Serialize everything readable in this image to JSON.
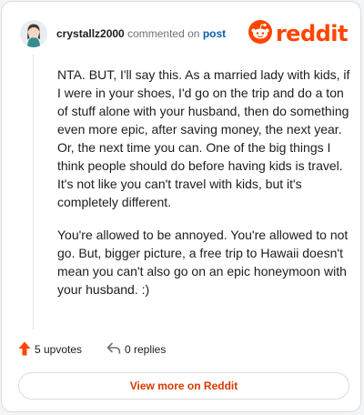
{
  "header": {
    "username": "crystallz2000",
    "action_text": "commented on",
    "post_link": "post",
    "logo_text": "reddit"
  },
  "comment": {
    "paragraphs": [
      "NTA. BUT, I'll say this. As a married lady with kids, if I were in your shoes, I'd go on the trip and do a ton of stuff alone with your husband, then do something even more epic, after saving money, the next year. Or, the next time you can. One of the big things I think people should do before having kids is travel. It's not like you can't travel with kids, but it's completely different.",
      "You're allowed to be annoyed. You're allowed to not go. But, bigger picture, a free trip to Hawaii doesn't mean you can't also go on an epic honeymoon with your husband. :)"
    ]
  },
  "actions": {
    "upvotes_label": "5 upvotes",
    "replies_label": "0 replies"
  },
  "footer": {
    "view_more_label": "View more on Reddit"
  },
  "colors": {
    "brand": "#ff4500",
    "link": "#0b5ea8",
    "button_text": "#d93900"
  },
  "icons": {
    "logo": "reddit-snoo-icon",
    "upvote": "upvote-arrow-icon",
    "reply": "reply-arrow-icon"
  }
}
